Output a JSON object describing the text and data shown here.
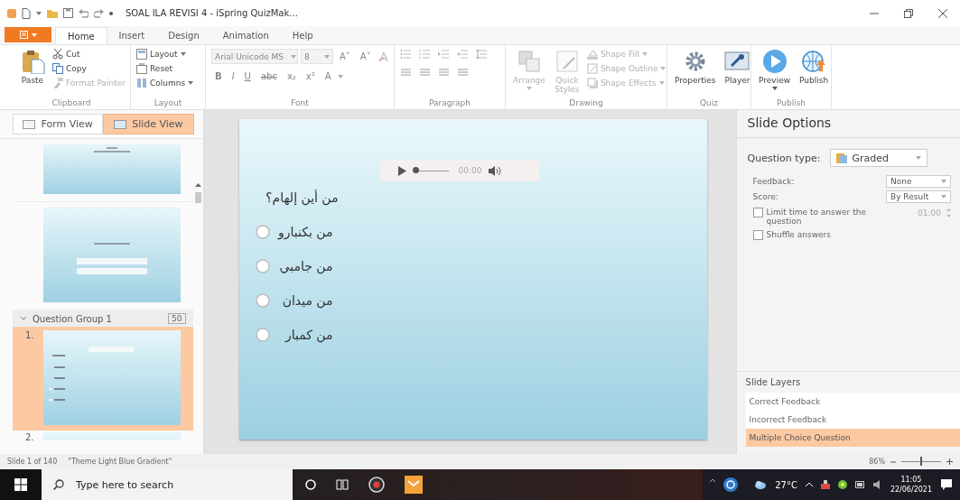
{
  "window": {
    "title": "SOAL ILA REVISI 4 - iSpring QuizMak..."
  },
  "ribbon_tabs": [
    {
      "label": "Home",
      "selected": true
    },
    {
      "label": "Insert",
      "selected": false
    },
    {
      "label": "Design",
      "selected": false
    },
    {
      "label": "Animation",
      "selected": false
    },
    {
      "label": "Help",
      "selected": false
    }
  ],
  "ribbon_groups": [
    {
      "kind": "clipboard",
      "label": "Clipboard",
      "commands": [
        {
          "label": "Paste",
          "kind": "large",
          "disabled": false,
          "dropdown": false
        },
        {
          "label": "Cut",
          "kind": "small",
          "disabled": false,
          "dropdown": false
        },
        {
          "label": "Copy",
          "kind": "small",
          "disabled": false,
          "dropdown": false
        },
        {
          "label": "Format Painter",
          "kind": "small",
          "disabled": true,
          "dropdown": false
        }
      ]
    },
    {
      "kind": "layout",
      "label": "Layout",
      "commands": [
        {
          "label": "Layout",
          "kind": "small",
          "disabled": false,
          "dropdown": true
        },
        {
          "label": "Reset",
          "kind": "small",
          "disabled": false,
          "dropdown": false
        },
        {
          "label": "Columns",
          "kind": "small",
          "disabled": false,
          "dropdown": true
        }
      ]
    },
    {
      "kind": "font",
      "label": "Font",
      "font_name": "Arial Unicode MS",
      "font_size": "8",
      "size_buttons": [
        "A˄",
        "A˅"
      ],
      "format_buttons": [
        "B",
        "I",
        "U",
        "abc",
        "x₂",
        "x²",
        "A"
      ]
    },
    {
      "kind": "paragraph",
      "label": "Paragraph"
    },
    {
      "kind": "drawing",
      "label": "Drawing",
      "commands": [
        {
          "label": "Arrange",
          "kind": "large",
          "disabled": true,
          "dropdown": true
        },
        {
          "label": "Quick Styles",
          "kind": "large",
          "disabled": true,
          "dropdown": false
        },
        {
          "label": "Shape Fill",
          "kind": "small",
          "disabled": true,
          "dropdown": true
        },
        {
          "label": "Shape Outline",
          "kind": "small",
          "disabled": true,
          "dropdown": true
        },
        {
          "label": "Shape Effects",
          "kind": "small",
          "disabled": true,
          "dropdown": true
        }
      ]
    },
    {
      "kind": "quiz",
      "label": "Quiz",
      "commands": [
        {
          "label": "Properties",
          "kind": "large",
          "disabled": false,
          "dropdown": false
        },
        {
          "label": "Player",
          "kind": "large",
          "disabled": false,
          "dropdown": false
        }
      ]
    },
    {
      "kind": "publish",
      "label": "Publish",
      "commands": [
        {
          "label": "Preview",
          "kind": "large",
          "disabled": false,
          "dropdown": true
        },
        {
          "label": "Publish",
          "kind": "large",
          "disabled": false,
          "dropdown": false
        }
      ]
    }
  ],
  "slides_panel": {
    "view_buttons": [
      {
        "label": "Form View",
        "selected": false
      },
      {
        "label": "Slide View",
        "selected": true
      }
    ],
    "items": [
      {
        "kind": "title_slide",
        "selected": false
      },
      {
        "kind": "form_slide",
        "selected": false
      },
      {
        "kind": "group",
        "label": "Question Group 1",
        "count": "50",
        "expanded": true,
        "children": [
          {
            "kind": "question_slide",
            "number": "1.",
            "selected": true
          },
          {
            "kind": "question_slide",
            "number": "2.",
            "selected": false
          }
        ]
      }
    ]
  },
  "slide": {
    "seek": {
      "level": 0
    },
    "audio_time": "00:00",
    "question": "من أين إلهام؟",
    "answers": [
      {
        "text": "من بكنبارو",
        "selected": false
      },
      {
        "text": "من جامبي",
        "selected": false
      },
      {
        "text": "من ميدان",
        "selected": false
      },
      {
        "text": "من كمبار",
        "selected": false
      }
    ]
  },
  "slide_options": {
    "title": "Slide Options",
    "question_type_label": "Question type:",
    "question_type": "Graded",
    "fields": [
      {
        "label": "Feedback:",
        "value": "None"
      },
      {
        "label": "Score:",
        "value": "By Result"
      }
    ],
    "checkboxes": [
      {
        "label": "Limit time to answer the question",
        "checked": false,
        "time": "01:00"
      },
      {
        "label": "Shuffle answers",
        "checked": false
      }
    ],
    "layers_title": "Slide Layers",
    "layers": [
      {
        "label": "Correct Feedback",
        "selected": false
      },
      {
        "label": "Incorrect Feedback",
        "selected": false
      },
      {
        "label": "Multiple Choice Question",
        "selected": true
      }
    ]
  },
  "status_bar": {
    "slide": "Slide 1 of 140",
    "theme": "\"Theme Light Blue Gradient\"",
    "zoom": "86%",
    "zoom_slider": {
      "level": 0.5
    }
  },
  "taskbar": {
    "search_placeholder": "Type here to search",
    "temperature": "27°C",
    "time": "11:05",
    "date": "22/06/2021"
  }
}
